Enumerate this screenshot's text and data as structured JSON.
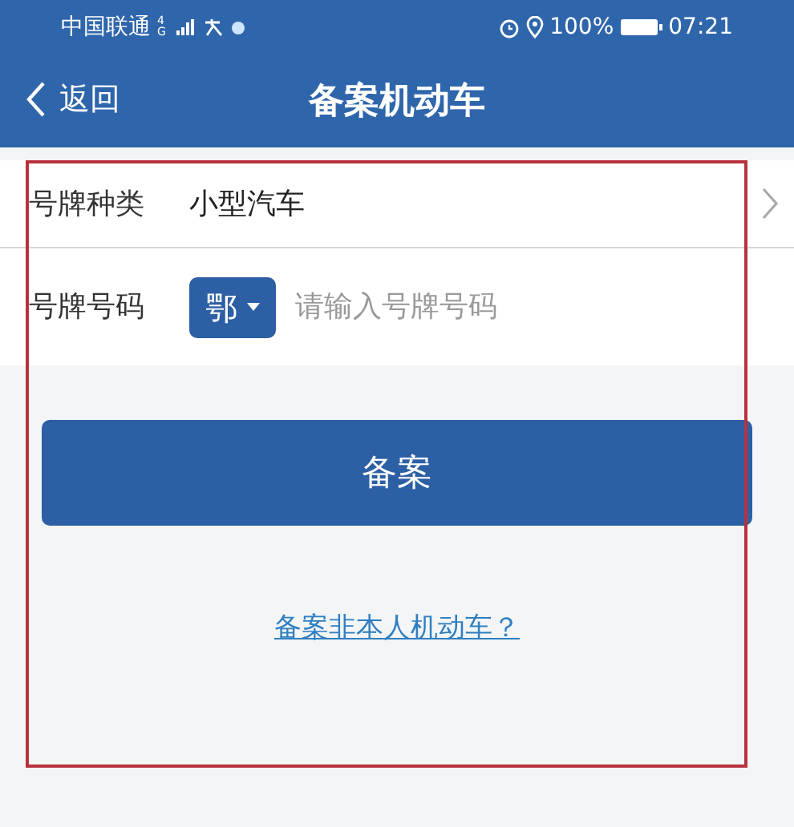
{
  "status_bar": {
    "carrier": "中国联通",
    "network": "4G",
    "battery": "100%",
    "time": "07:21"
  },
  "nav_bar": {
    "back": "返回",
    "title": "备案机动车"
  },
  "form": {
    "rows": [
      {
        "kind": "select",
        "label": "号牌种类",
        "value": "小型汽车"
      },
      {
        "kind": "plate",
        "label": "号牌号码",
        "prefix": "鄂",
        "placeholder": "请输入号牌号码"
      }
    ]
  },
  "submit_button": "备案",
  "link": "备案非本人机动车？"
}
